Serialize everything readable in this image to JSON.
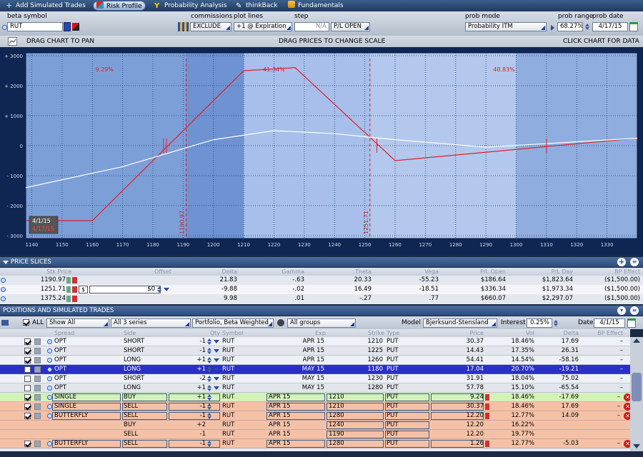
{
  "tabs": [
    {
      "label": "Add Simulated Trades",
      "icon": "plus-icon"
    },
    {
      "label": "Risk Profile",
      "icon": "risk-profile-icon",
      "active": true
    },
    {
      "label": "Probability Analysis",
      "icon": "probability-icon"
    },
    {
      "label": "thinkBack",
      "icon": "thinkback-icon"
    },
    {
      "label": "Fundamentals",
      "icon": "fundamentals-icon"
    }
  ],
  "controls": {
    "beta_symbol_label": "beta symbol",
    "beta_symbol_value": "RUT",
    "commissions_label": "commissions",
    "commissions_value": "EXCLUDE",
    "plot_lines_label": "plot lines",
    "plot_lines_value": "+1 @ Expiration",
    "step_label": "step",
    "step_value": "N/A",
    "pl_mode": "P/L OPEN",
    "prob_mode_label": "prob mode",
    "prob_mode_value": "Probability ITM",
    "prob_range_label": "prob range",
    "prob_range_value": "68.27%",
    "prob_date_label": "prob date",
    "prob_date_value": "4/17/15"
  },
  "toolbar": {
    "drag_pan": "DRAG CHART TO PAN",
    "drag_prices": "DRAG PRICES TO CHANGE SCALE",
    "click_chart": "CLICK CHART FOR DATA"
  },
  "chart_data": {
    "type": "line",
    "x_ticks": [
      1140,
      1150,
      1160,
      1170,
      1180,
      1190,
      1200,
      1210,
      1220,
      1230,
      1240,
      1250,
      1260,
      1270,
      1280,
      1290,
      1300,
      1310,
      1320,
      1330
    ],
    "y_ticks": [
      "+ 3000",
      "+ 2000",
      "+ 1000",
      "0",
      "- 1000",
      "- 2000",
      "- 3000"
    ],
    "y_values": [
      3000,
      2000,
      1000,
      0,
      -1000,
      -2000,
      -3000
    ],
    "xlim": [
      1138,
      1340
    ],
    "ylim": [
      -3000,
      3000
    ],
    "series": [
      {
        "color": "#e0202a",
        "x": [
          1138,
          1160,
          1210,
          1227,
          1260,
          1340
        ],
        "y": [
          -2500,
          -2500,
          2500,
          2600,
          -500,
          250
        ]
      },
      {
        "color": "#ffffff",
        "x": [
          1138,
          1170,
          1200,
          1220,
          1240,
          1260,
          1290,
          1340
        ],
        "y": [
          -1400,
          -700,
          200,
          500,
          400,
          200,
          -50,
          250
        ]
      }
    ],
    "prob_regions": [
      {
        "label": "9.29%",
        "x_at": 1164
      },
      {
        "label": "41.34%",
        "x_at": 1220
      },
      {
        "label": "48.83%",
        "x_at": 1296
      }
    ],
    "markers": [
      {
        "label": "1190.97",
        "x": 1190.97
      },
      {
        "label": "1251.71",
        "x": 1251.71
      }
    ],
    "date_labels": [
      "4/1/15",
      "4/17/15"
    ],
    "grid": true
  },
  "price_slices": {
    "title": "PRICE SLICES",
    "headers": [
      "Stk Price",
      "Offset",
      "Delta",
      "Gamma",
      "Theta",
      "Vega",
      "P/L Open",
      "P/L Day",
      "BP Effect"
    ],
    "rows": [
      {
        "price": "1190.97",
        "offset": "",
        "delta": "21.83",
        "gamma": "-.63",
        "theta": "20.33",
        "vega": "-55.23",
        "pl_open": "$186.64",
        "pl_day": "$1,823.64",
        "bp": "($1,500.00)"
      },
      {
        "price": "1251.71",
        "offset": "$0",
        "delta": "-9.88",
        "gamma": "-.02",
        "theta": "16.49",
        "vega": "-18.51",
        "pl_open": "$336.34",
        "pl_day": "$1,973.34",
        "bp": "($1,500.00)"
      },
      {
        "price": "1375.24",
        "offset": "",
        "delta": "9.98",
        "gamma": ".01",
        "theta": "-.27",
        "vega": ".77",
        "pl_open": "$660.07",
        "pl_day": "$2,297.07",
        "bp": "($1,500.00)"
      }
    ]
  },
  "positions": {
    "title": "POSITIONS AND SIMULATED TRADES",
    "filters": {
      "all": "ALL",
      "show": "Show All",
      "series": "All 3 series",
      "portfolio": "Portfolio, Beta Weighted",
      "groups": "All groups",
      "model_label": "Model",
      "model_value": "Bjerksund-Stensland",
      "interest_label": "Interest",
      "interest_value": "0.25%",
      "date_label": "Date",
      "date_value": "4/1/15"
    },
    "headers": [
      "Spread",
      "Side",
      "Qty",
      "Symbol",
      "Exp",
      "Strike",
      "Type",
      "Price",
      "Vol",
      "Delta",
      "BP Effect"
    ],
    "rows": [
      {
        "kind": "opt",
        "checked": true,
        "spread": "OPT",
        "side": "SHORT",
        "qty": "-1",
        "symbol": "RUT",
        "exp": "APR 15",
        "strike": "1210",
        "type": "PUT",
        "price": "30.37",
        "vol": "18.46%",
        "delta": "17.69",
        "bp": "–"
      },
      {
        "kind": "opt",
        "checked": true,
        "spread": "OPT",
        "side": "SHORT",
        "qty": "-1",
        "symbol": "RUT",
        "exp": "APR 15",
        "strike": "1225",
        "type": "PUT",
        "price": "14.43",
        "vol": "17.35%",
        "delta": "26.31",
        "bp": "–"
      },
      {
        "kind": "opt",
        "checked": true,
        "spread": "OPT",
        "side": "LONG",
        "qty": "+1",
        "symbol": "RUT",
        "exp": "APR 15",
        "strike": "1260",
        "type": "PUT",
        "price": "54.41",
        "vol": "14.54%",
        "delta": "-58.16",
        "bp": "–"
      },
      {
        "kind": "sel",
        "checked": false,
        "spread": "OPT",
        "side": "LONG",
        "qty": "+1",
        "symbol": "RUT",
        "exp": "MAY 15",
        "strike": "1180",
        "type": "PUT",
        "price": "17.04",
        "vol": "20.70%",
        "delta": "-19.21",
        "bp": "–"
      },
      {
        "kind": "opt",
        "checked": false,
        "spread": "OPT",
        "side": "SHORT",
        "qty": "-2",
        "symbol": "RUT",
        "exp": "MAY 15",
        "strike": "1230",
        "type": "PUT",
        "price": "31.91",
        "vol": "18.04%",
        "delta": "75.02",
        "bp": "–"
      },
      {
        "kind": "opt",
        "checked": false,
        "spread": "OPT",
        "side": "LONG",
        "qty": "+1",
        "symbol": "RUT",
        "exp": "MAY 15",
        "strike": "1280",
        "type": "PUT",
        "price": "57.78",
        "vol": "15.10%",
        "delta": "-65.54",
        "bp": "–"
      },
      {
        "kind": "sim-green",
        "checked": true,
        "spread": "SINGLE",
        "side": "BUY",
        "qty": "+1",
        "symbol": "RUT",
        "exp": "APR 15",
        "strike": "1210",
        "type": "PUT",
        "price": "9.24",
        "vol": "18.46%",
        "delta": "-17.69",
        "bp": "–"
      },
      {
        "kind": "sim",
        "checked": true,
        "spread": "SINGLE",
        "side": "SELL",
        "qty": "-1",
        "symbol": "RUT",
        "exp": "APR 15",
        "strike": "1210",
        "type": "PUT",
        "price": "30.37",
        "vol": "18.46%",
        "delta": "17.69",
        "bp": "–"
      },
      {
        "kind": "sim",
        "checked": true,
        "spread": "BUTTERFLY",
        "side": "SELL",
        "qty": "-1",
        "symbol": "RUT",
        "exp": "APR 15",
        "strike": "1280",
        "type": "PUT",
        "price": "12.20",
        "vol": "12.77%",
        "delta": "14.09",
        "bp": "–"
      },
      {
        "kind": "leg",
        "checked": false,
        "spread": "",
        "side": "BUY",
        "qty": "+2",
        "symbol": "RUT",
        "exp": "APR 15",
        "strike": "1240",
        "type": "PUT",
        "price": "12.20",
        "vol": "16.22%",
        "delta": "",
        "bp": ""
      },
      {
        "kind": "leg",
        "checked": false,
        "spread": "",
        "side": "SELL",
        "qty": "-1",
        "symbol": "RUT",
        "exp": "APR 15",
        "strike": "1190",
        "type": "PUT",
        "price": "12.20",
        "vol": "19.77%",
        "delta": "",
        "bp": ""
      },
      {
        "kind": "sim",
        "checked": true,
        "spread": "BUTTERFLY",
        "side": "SELL",
        "qty": "-1",
        "symbol": "RUT",
        "exp": "APR 15",
        "strike": "1280",
        "type": "PUT",
        "price": "1.26",
        "vol": "12.77%",
        "delta": "-5.03",
        "bp": "–"
      }
    ]
  }
}
